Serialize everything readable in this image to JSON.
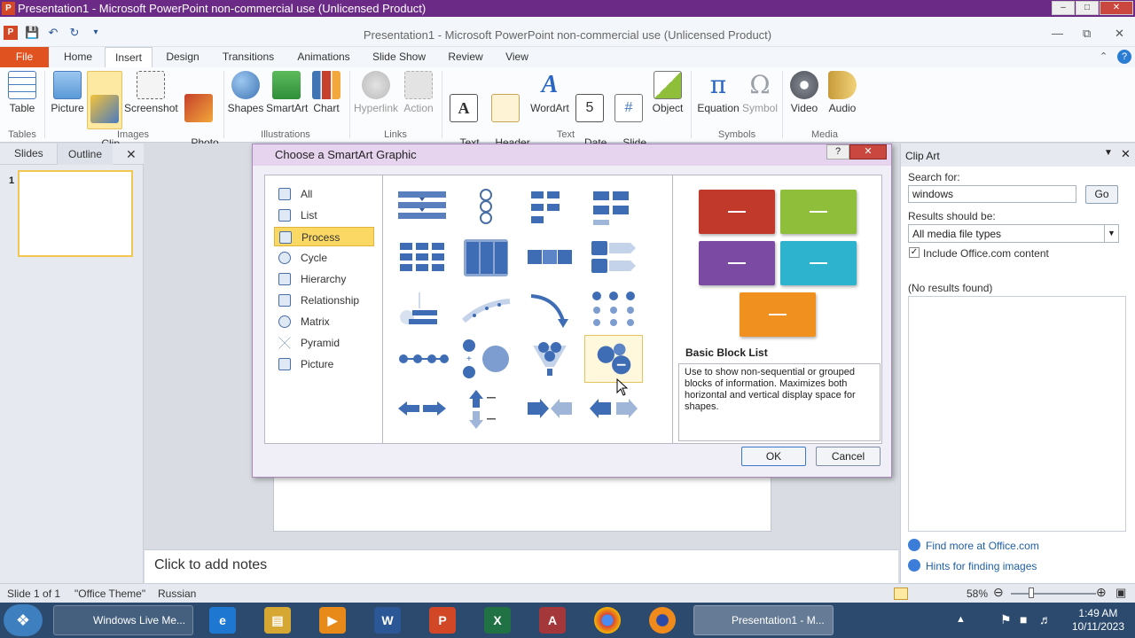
{
  "os": {
    "title": "Presentation1 - Microsoft PowerPoint non-commercial use (Unlicensed Product)",
    "app_icon": "P"
  },
  "ppt": {
    "window_title": "Presentation1  -  Microsoft PowerPoint non-commercial use (Unlicensed Product)"
  },
  "tabs": [
    "File",
    "Home",
    "Insert",
    "Design",
    "Transitions",
    "Animations",
    "Slide Show",
    "Review",
    "View"
  ],
  "ribbon": {
    "table": "Table",
    "picture": "Picture",
    "clip_art": "Clip\nArt",
    "screenshot": "Screenshot",
    "photo_album": "Photo\nAlbum",
    "shapes": "Shapes",
    "smartart": "SmartArt",
    "chart": "Chart",
    "hyperlink": "Hyperlink",
    "action": "Action",
    "text_box": "Text\nBox",
    "header_footer": "Header\n& Footer",
    "wordart": "WordArt",
    "date_time": "Date\n& Time",
    "slide_number": "Slide\nNumber",
    "object": "Object",
    "equation": "Equation",
    "symbol": "Symbol",
    "video": "Video",
    "audio": "Audio",
    "groups": {
      "tables": "Tables",
      "images": "Images",
      "illustrations": "Illustrations",
      "links": "Links",
      "text": "Text",
      "symbols": "Symbols",
      "media": "Media"
    }
  },
  "left_panel": {
    "slides_tab": "Slides",
    "outline_tab": "Outline",
    "slide_num": "1"
  },
  "notes": {
    "placeholder": "Click to add notes"
  },
  "clipart": {
    "title": "Clip Art",
    "search_label": "Search for:",
    "search_value": "windows",
    "go": "Go",
    "results_label": "Results should be:",
    "media_type": "All media file types",
    "include_office": "Include Office.com content",
    "no_results": "(No results found)",
    "find_more": "Find more at Office.com",
    "hints": "Hints for finding images"
  },
  "status": {
    "slide": "Slide 1 of 1",
    "theme": "\"Office Theme\"",
    "language": "Russian",
    "zoom": "58%"
  },
  "taskbar": {
    "windows_live": "Windows Live Me...",
    "presentation": "Presentation1 - M...",
    "time": "1:49 AM",
    "date": "10/11/2023"
  },
  "dialog": {
    "title": "Choose a SmartArt Graphic",
    "categories": [
      "All",
      "List",
      "Process",
      "Cycle",
      "Hierarchy",
      "Relationship",
      "Matrix",
      "Pyramid",
      "Picture"
    ],
    "preview_title": "Basic Block List",
    "preview_desc": "Use to show non-sequential or grouped blocks of information. Maximizes both horizontal and vertical display space for shapes.",
    "ok": "OK",
    "cancel": "Cancel",
    "block_colors": [
      "#c0392b",
      "#8fbf3a",
      "#7b4ba3",
      "#2eb3cf",
      "#f0901e"
    ]
  }
}
